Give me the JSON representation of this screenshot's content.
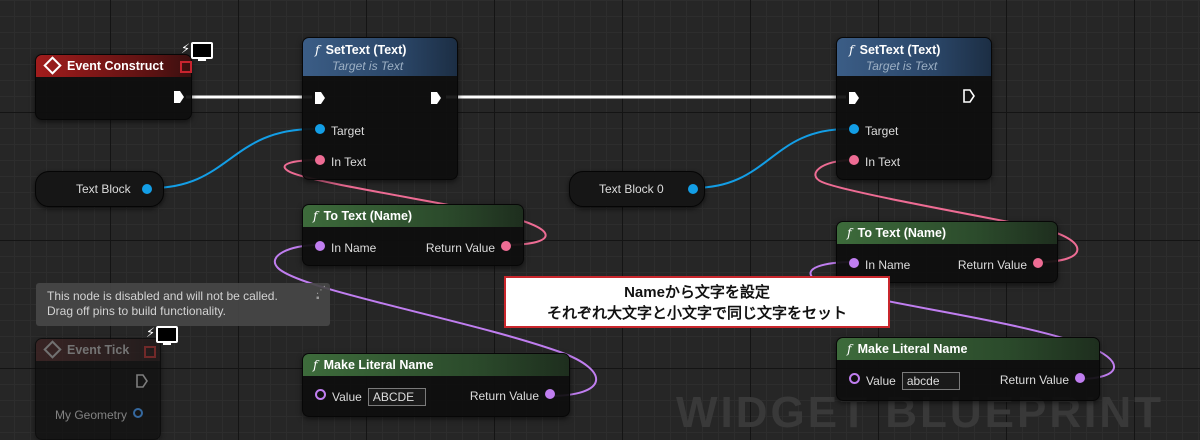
{
  "watermark": "WIDGET BLUEPRINT",
  "event_construct": {
    "title": "Event Construct"
  },
  "event_tick": {
    "title": "Event Tick",
    "pin_geometry": "My Geometry"
  },
  "tooltip": {
    "line1": "This node is disabled and will not be called.",
    "line2": "Drag off pins to build functionality."
  },
  "text_block_var": {
    "label": "Text Block"
  },
  "text_block_0_var": {
    "label": "Text Block 0"
  },
  "settext_nodes": [
    {
      "title": "SetText (Text)",
      "subtitle": "Target is Text",
      "pin_target": "Target",
      "pin_in_text": "In Text"
    },
    {
      "title": "SetText (Text)",
      "subtitle": "Target is Text",
      "pin_target": "Target",
      "pin_in_text": "In Text"
    }
  ],
  "totext_nodes": [
    {
      "title": "To Text (Name)",
      "pin_in": "In Name",
      "pin_out": "Return Value"
    },
    {
      "title": "To Text (Name)",
      "pin_in": "In Name",
      "pin_out": "Return Value"
    }
  ],
  "literal_nodes": [
    {
      "title": "Make Literal Name",
      "pin_value": "Value",
      "value": "ABCDE",
      "pin_out": "Return Value"
    },
    {
      "title": "Make Literal Name",
      "pin_value": "Value",
      "value": "abcde",
      "pin_out": "Return Value"
    }
  ],
  "annotation": {
    "line1": "Nameから文字を設定",
    "line2": "それぞれ大文字と小文字で同じ文字をセット"
  },
  "colors": {
    "exec_wire": "#ffffff",
    "object_wire": "#139ee6",
    "text_wire": "#ee6c94",
    "name_wire": "#c07ef0",
    "event_header": "#a11c1c",
    "function_header": "#3b5d86",
    "pure_header": "#3d6b3b",
    "annotation_border": "#c9262c"
  }
}
